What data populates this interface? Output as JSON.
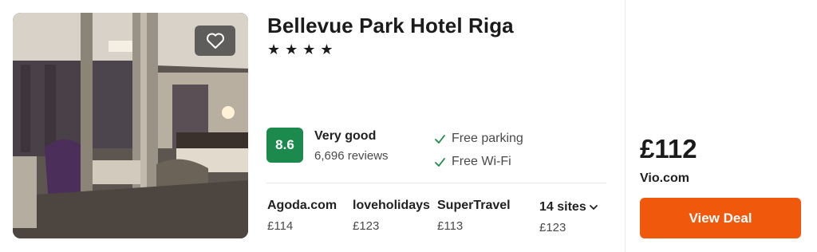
{
  "hotel": {
    "name": "Bellevue Park Hotel Riga",
    "stars": [
      "★",
      "★",
      "★",
      "★"
    ]
  },
  "rating": {
    "score": "8.6",
    "label": "Very good",
    "reviews": "6,696 reviews",
    "badge_color": "#1b8a4c"
  },
  "amenities": [
    "Free parking",
    "Free Wi-Fi"
  ],
  "sites": [
    {
      "name": "Agoda.com",
      "price": "£114"
    },
    {
      "name": "loveholidays",
      "price": "£123"
    },
    {
      "name": "SuperTravel",
      "price": "£113"
    }
  ],
  "more_sites": {
    "label": "14 sites",
    "price": "£123"
  },
  "deal": {
    "price": "£112",
    "provider": "Vio.com",
    "button_label": "View Deal",
    "button_color": "#f0580b"
  },
  "icons": {
    "favorite": "heart-icon",
    "amenity": "check-icon",
    "dropdown": "chevron-down-icon"
  }
}
